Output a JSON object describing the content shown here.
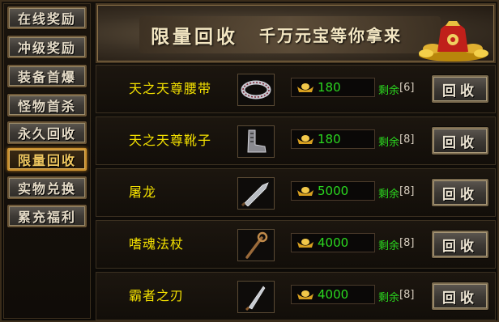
{
  "sidebar": {
    "items": [
      {
        "label": "在线奖励"
      },
      {
        "label": "冲级奖励"
      },
      {
        "label": "装备首爆"
      },
      {
        "label": "怪物首杀"
      },
      {
        "label": "永久回收"
      },
      {
        "label": "限量回收",
        "active": true
      },
      {
        "label": "实物兑换"
      },
      {
        "label": "累充福利"
      }
    ]
  },
  "banner": {
    "title": "限量回收",
    "subtitle": "千万元宝等你拿来"
  },
  "items": [
    {
      "name": "天之天尊腰带",
      "icon": "belt-icon",
      "price": "180",
      "remain_label": "剩余",
      "remain_count": "[6]",
      "button": "回收"
    },
    {
      "name": "天之天尊靴子",
      "icon": "boots-icon",
      "price": "180",
      "remain_label": "剩余",
      "remain_count": "[8]",
      "button": "回收"
    },
    {
      "name": "屠龙",
      "icon": "sword-icon",
      "price": "5000",
      "remain_label": "剩余",
      "remain_count": "[8]",
      "button": "回收"
    },
    {
      "name": "嗜魂法杖",
      "icon": "staff-icon",
      "price": "4000",
      "remain_label": "剩余",
      "remain_count": "[8]",
      "button": "回收"
    },
    {
      "name": "霸者之刃",
      "icon": "blade-icon",
      "price": "4000",
      "remain_label": "剩余",
      "remain_count": "[8]",
      "button": "回收"
    }
  ],
  "colors": {
    "item_name": "#f4e100",
    "price": "#2bd81f",
    "active_tab": "#c9902f"
  }
}
